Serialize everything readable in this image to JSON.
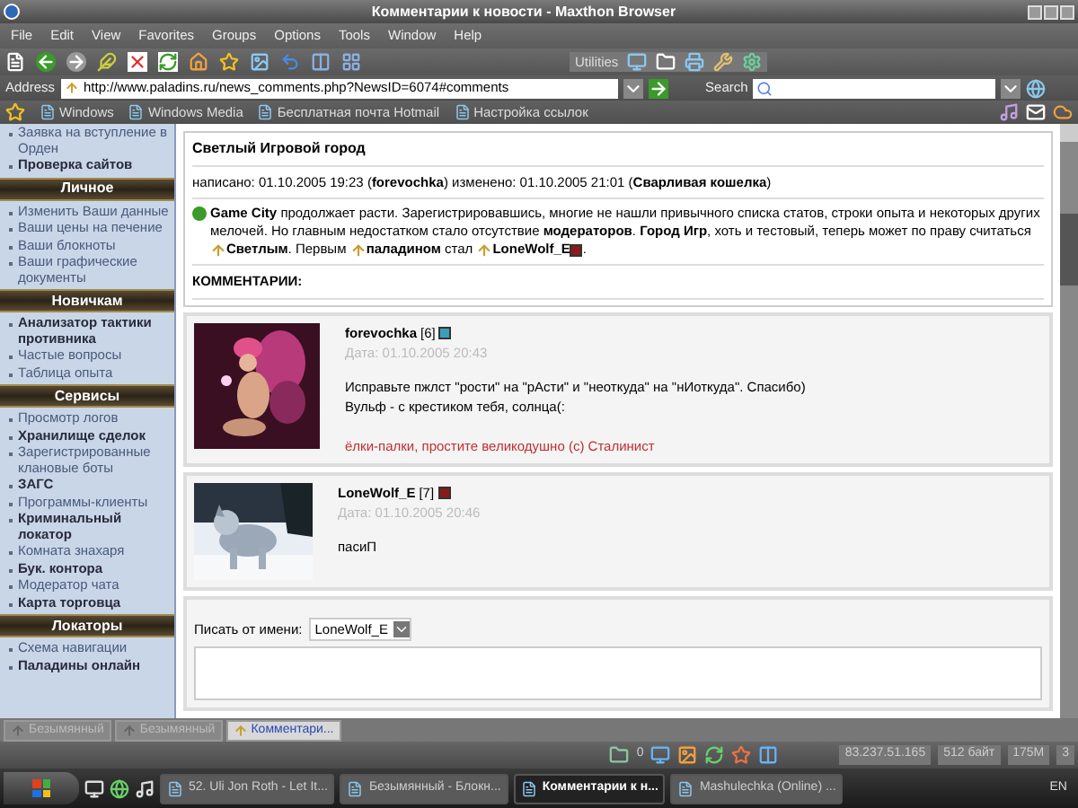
{
  "window": {
    "title": "Комментарии к новости - Maxthon Browser"
  },
  "menu": [
    "File",
    "Edit",
    "View",
    "Favorites",
    "Groups",
    "Options",
    "Tools",
    "Window",
    "Help"
  ],
  "toolbar": {
    "utilities_label": "Utilities"
  },
  "address_bar": {
    "label": "Address",
    "url": "http://www.paladins.ru/news_comments.php?NewsID=6074#comments",
    "search_label": "Search"
  },
  "links_bar": [
    "Windows",
    "Windows Media",
    "Бесплатная почта Hotmail",
    "Настройка ссылок"
  ],
  "sidebar": {
    "top_items": [
      {
        "label": "Заявка на вступление в Орден",
        "bold": false
      },
      {
        "label": "Проверка сайтов",
        "bold": true
      }
    ],
    "sections": [
      {
        "title": "Личное",
        "items": [
          {
            "label": "Изменить Ваши данные",
            "bold": false
          },
          {
            "label": "Ваши цены на печение",
            "bold": false
          },
          {
            "label": "Ваши блокноты",
            "bold": false
          },
          {
            "label": "Ваши графические документы",
            "bold": false
          }
        ]
      },
      {
        "title": "Новичкам",
        "items": [
          {
            "label": "Анализатор тактики противника",
            "bold": true
          },
          {
            "label": "Частые вопросы",
            "bold": false
          },
          {
            "label": "Таблица опыта",
            "bold": false
          }
        ]
      },
      {
        "title": "Сервисы",
        "items": [
          {
            "label": "Просмотр логов",
            "bold": false
          },
          {
            "label": "Хранилище сделок",
            "bold": true
          },
          {
            "label": "Зарегистрированные клановые боты",
            "bold": false
          },
          {
            "label": "ЗАГС",
            "bold": true
          },
          {
            "label": "Программы-клиенты",
            "bold": false
          },
          {
            "label": "Криминальный локатор",
            "bold": true
          },
          {
            "label": "Комната знахаря",
            "bold": false
          },
          {
            "label": "Бук. контора",
            "bold": true
          },
          {
            "label": "Модератор чата",
            "bold": false
          },
          {
            "label": "Карта торговца",
            "bold": true
          }
        ]
      },
      {
        "title": "Локаторы",
        "items": [
          {
            "label": "Схема навигации",
            "bold": false
          },
          {
            "label": "Паладины онлайн",
            "bold": true
          }
        ]
      }
    ]
  },
  "article": {
    "title": "Светлый Игровой город",
    "meta": "написано: 01.10.2005 19:23 (**forevochka**)  изменено: 01.10.2005 21:01 (**Сварливая кошелка**)",
    "body": [
      {
        "kind": "city-mark"
      },
      {
        "kind": "text",
        "text": "**Game City** продолжает расти. Зарегистрировавшись, многие не нашли привычного списка статов, строки опыта и некоторых других мелочей. Но главным недостатком стало отсутствие **модераторов**. **Город Игр**, хоть и тестовый, теперь может по праву считаться "
      },
      {
        "kind": "rank-mark"
      },
      {
        "kind": "text",
        "text": "**Светлым**. Первым "
      },
      {
        "kind": "rank-mark"
      },
      {
        "kind": "text",
        "text": "**паладином** стал "
      },
      {
        "kind": "rank-mark"
      },
      {
        "kind": "text",
        "text": "**LoneWolf_E**"
      },
      {
        "kind": "clan-mark",
        "color": "#8b1a1a"
      },
      {
        "kind": "text",
        "text": "."
      }
    ]
  },
  "comments_heading": "КОММЕНТАРИИ:",
  "comments": [
    {
      "author": "forevochka",
      "rank": "[6]",
      "color": "#3aa0b8",
      "date": "Дата: 01.10.2005 20:43",
      "lines": [
        "Исправьте пжлст \"рости\" на \"рАсти\" и \"неоткуда\" на \"нИоткуда\". Спасибо)",
        "Вульф - с крестиком тебя, солнца(:"
      ],
      "signature": "ёлки-палки, простите великодушно (с) Сталинист"
    },
    {
      "author": "LoneWolf_E",
      "rank": "[7]",
      "color": "#8b1a1a",
      "date": "Дата: 01.10.2005 20:46",
      "lines": [
        "пасиП"
      ]
    }
  ],
  "reply_form": {
    "label": "Писать от имени:",
    "author": "LoneWolf_E"
  },
  "tabs": [
    {
      "label": "Безымянный",
      "selected": false
    },
    {
      "label": "Безымянный",
      "selected": false
    },
    {
      "label": "Комментари...",
      "selected": true
    }
  ],
  "status_bar": {
    "count": "0",
    "ip": "83.237.51.165",
    "size": "512 байт",
    "memory": "175M",
    "number": "3"
  },
  "taskbar": {
    "tasks": [
      {
        "label": "52. Uli Jon Roth - Let It...",
        "selected": false
      },
      {
        "label": "Безымянный - Блокн...",
        "selected": false
      },
      {
        "label": "Комментарии к н...",
        "selected": true
      },
      {
        "label": "Mashulechka (Online) ...",
        "selected": false
      }
    ],
    "lang": "EN"
  }
}
